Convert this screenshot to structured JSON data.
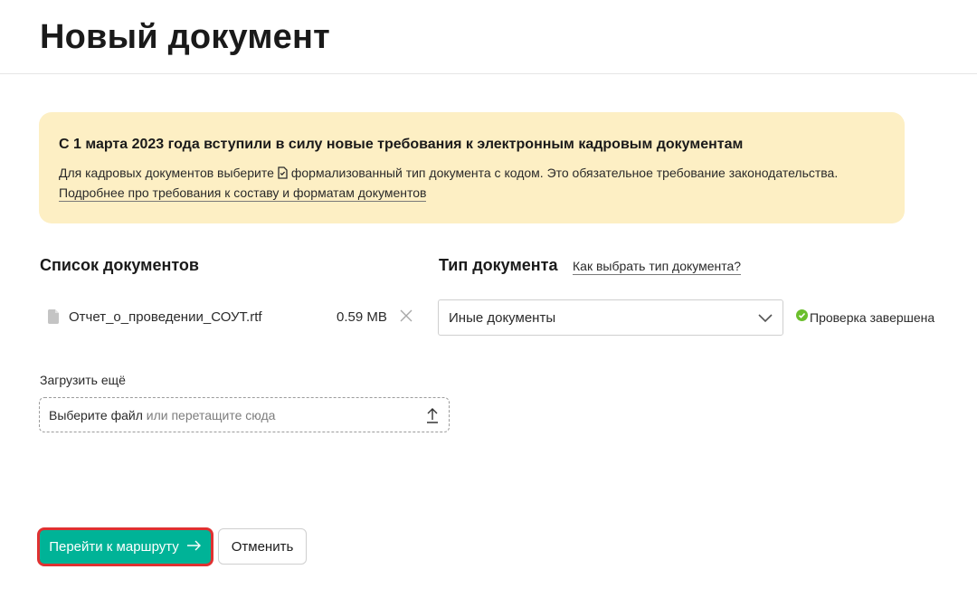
{
  "page": {
    "title": "Новый документ"
  },
  "notice": {
    "title": "С 1 марта 2023 года вступили в силу новые требования к электронным кадровым документам",
    "text_before_icon": "Для кадровых документов выберите",
    "icon": "document-code-icon",
    "text_after_icon": "формализованный тип документа с кодом. Это обязательное требование законодательства.",
    "link": "Подробнее про требования к составу и форматам документов"
  },
  "documents": {
    "section_title": "Список документов",
    "files": [
      {
        "icon": "file-icon",
        "name": "Отчет_о_проведении_СОУТ.rtf",
        "size": "0.59 MB",
        "remove_icon": "close-icon"
      }
    ]
  },
  "doc_type": {
    "section_title": "Тип документа",
    "help_link": "Как выбрать тип документа?",
    "selected": "Иные документы",
    "status": "Проверка завершена",
    "status_color": "#6bbf2c"
  },
  "upload": {
    "label": "Загрузить ещё",
    "choose_text": "Выберите файл",
    "drag_text": "или перетащите сюда",
    "icon": "upload-icon"
  },
  "actions": {
    "primary_label": "Перейти к маршруту",
    "primary_color": "#00b397",
    "highlight_color": "#e03131",
    "secondary_label": "Отменить"
  }
}
